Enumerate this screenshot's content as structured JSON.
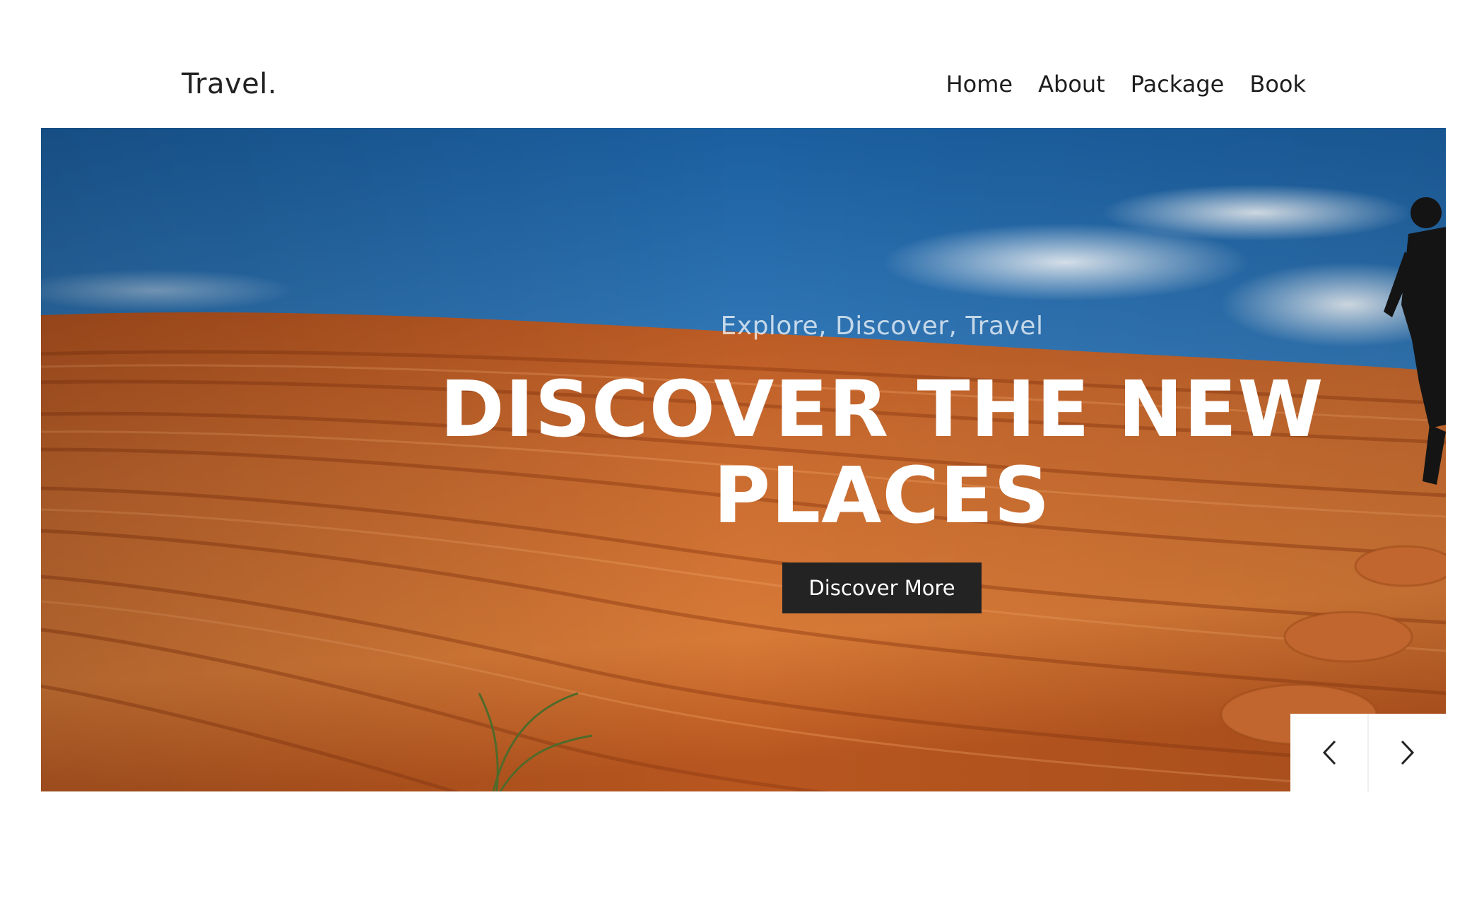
{
  "header": {
    "logo": "Travel.",
    "nav": [
      {
        "label": "Home"
      },
      {
        "label": "About"
      },
      {
        "label": "Package"
      },
      {
        "label": "Book"
      }
    ]
  },
  "hero": {
    "eyebrow": "Explore, Discover, Travel",
    "title_line1": "DISCOVER THE NEW",
    "title_line2": "PLACES",
    "cta_label": "Discover More",
    "controls": {
      "prev_icon": "chevron-left-icon",
      "next_icon": "chevron-right-icon"
    }
  },
  "colors": {
    "cta_bg": "#232323",
    "sky_top": "#1b5fa0",
    "sand": "#c4662c"
  }
}
